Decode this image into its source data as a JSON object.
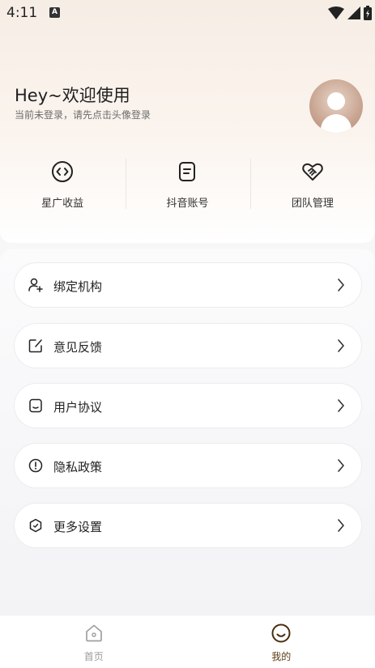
{
  "status_bar": {
    "time": "4:11",
    "notification_glyph": "A"
  },
  "header": {
    "title": "Hey~欢迎使用",
    "subtitle": "当前未登录，请先点击头像登录"
  },
  "quick_actions": [
    {
      "label": "星广收益",
      "icon": "code-diamond-icon"
    },
    {
      "label": "抖音账号",
      "icon": "document-icon"
    },
    {
      "label": "团队管理",
      "icon": "handshake-icon"
    }
  ],
  "menu": [
    {
      "label": "绑定机构",
      "icon": "add-user-icon"
    },
    {
      "label": "意见反馈",
      "icon": "edit-icon"
    },
    {
      "label": "用户协议",
      "icon": "agreement-icon"
    },
    {
      "label": "隐私政策",
      "icon": "alert-circle-icon"
    },
    {
      "label": "更多设置",
      "icon": "settings-hexagon-icon"
    }
  ],
  "bottom_nav": [
    {
      "label": "首页",
      "icon": "home-icon",
      "active": false
    },
    {
      "label": "我的",
      "icon": "smile-icon",
      "active": true
    }
  ],
  "colors": {
    "accent": "#5a3a12",
    "inactive": "#9a9a9a"
  }
}
